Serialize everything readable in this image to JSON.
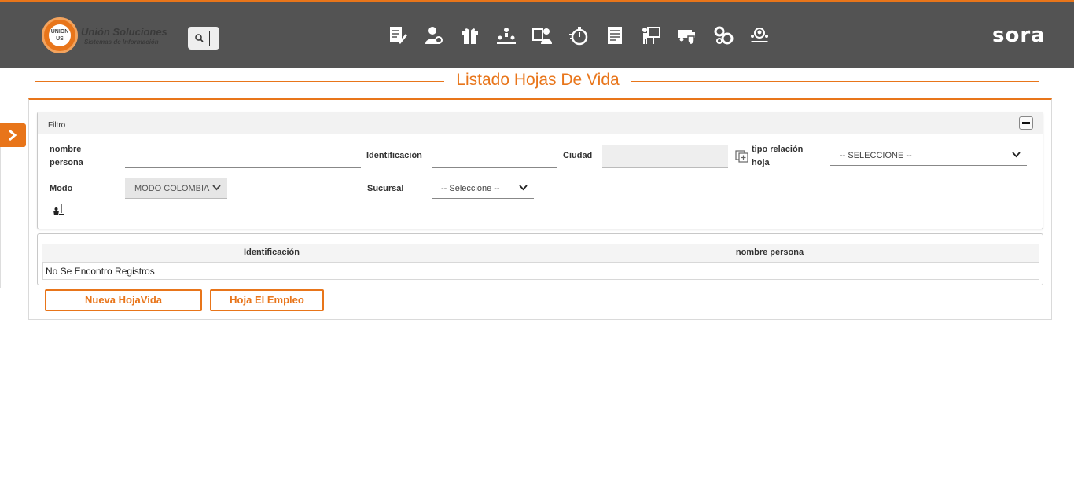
{
  "header": {
    "logo_badge": "UNION US",
    "logo_name": "Unión Soluciones",
    "logo_tagline": "Sistemas de Información",
    "brand": "sora",
    "nav_icons": [
      "document-edit-icon",
      "user-settings-icon",
      "gift-icon",
      "hierarchy-icon",
      "user-card-icon",
      "stopwatch-icon",
      "report-icon",
      "presentation-icon",
      "truck-shield-icon",
      "gears-icon",
      "user-group-icon"
    ]
  },
  "page": {
    "title": "Listado Hojas De Vida"
  },
  "filter": {
    "title": "Filtro",
    "nombre_label": "nombre persona",
    "nombre_value": "",
    "identificacion_label": "Identificación",
    "identificacion_value": "",
    "ciudad_label": "Ciudad",
    "ciudad_value": "",
    "tipo_label": "tipo relación hoja",
    "tipo_value": "-- SELECCIONE --",
    "modo_label": "Modo",
    "modo_value": "MODO COLOMBIA",
    "sucursal_label": "Sucursal",
    "sucursal_value": "-- Seleccione --"
  },
  "grid": {
    "columns": [
      "Identificación",
      "nombre persona"
    ],
    "empty_message": "No Se Encontro Registros"
  },
  "actions": {
    "new_label": "Nueva HojaVida",
    "empleo_label": "Hoja El Empleo"
  },
  "colors": {
    "accent": "#e8751a",
    "topbar": "#535353"
  }
}
